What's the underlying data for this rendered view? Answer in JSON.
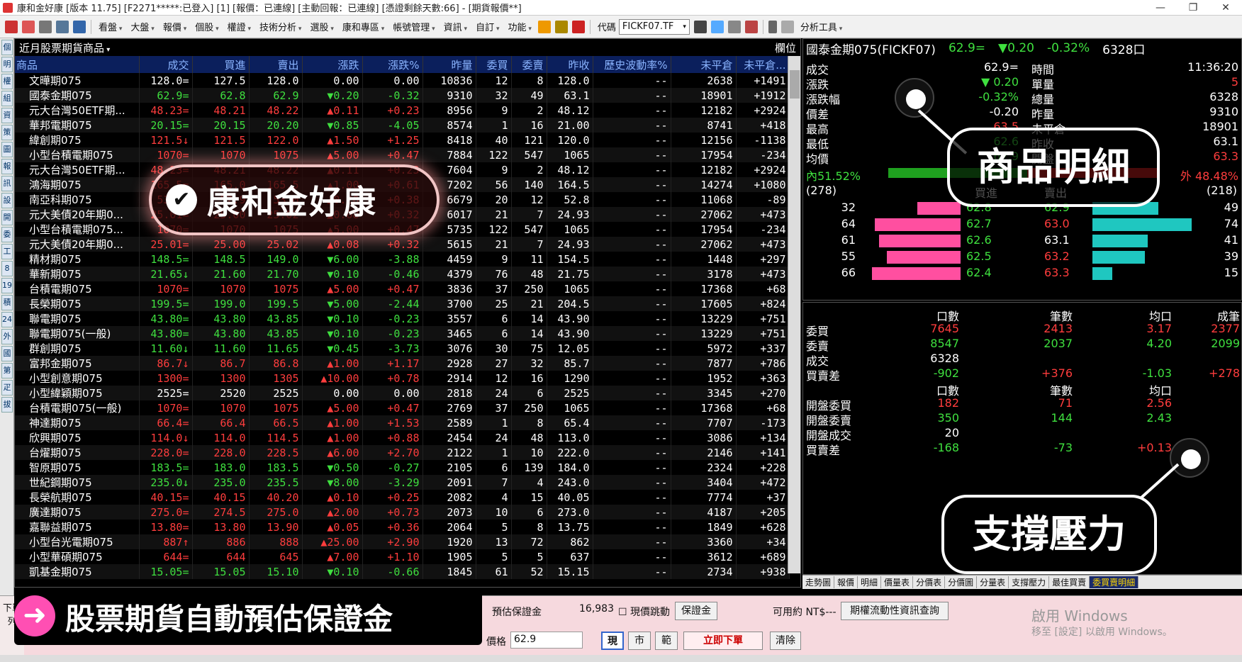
{
  "window": {
    "title": "康和金好康 [版本 11.75] [F2271*****:已登入] [1] [報價：已連線] [主動回報：已連線] [憑證剩餘天數:66] - [期貨報價**]"
  },
  "toolbar": {
    "menus": [
      "看盤",
      "大盤",
      "報價",
      "個股",
      "權證",
      "技術分析",
      "選股",
      "康和專區",
      "帳號管理",
      "資訊",
      "自訂",
      "功能"
    ],
    "code_label": "代碼",
    "code_value": "FICKF07.TF",
    "analysis_tools": "分析工具"
  },
  "left_tabs": [
    "個",
    "明",
    "權",
    "組",
    "資",
    "策",
    "圖",
    "報",
    "訊",
    "設",
    "開",
    "委",
    "工",
    "8",
    "19",
    "積",
    "24",
    "外",
    "國",
    "第",
    "疋",
    "拔"
  ],
  "quote_panel": {
    "selector": "近月股票期貨商品",
    "right_label": "欄位",
    "columns": [
      "商品",
      "成交",
      "買進",
      "賣出",
      "漲跌",
      "漲跌%",
      "昨量",
      "委買",
      "委賣",
      "昨收",
      "歷史波動率%",
      "未平倉",
      "未平倉..."
    ],
    "rows": [
      {
        "name": "文曄期075",
        "last": "128.0=",
        "bid": "127.5",
        "ask": "128.0",
        "chg": "0.00",
        "pct": "0.00",
        "vol": "10836",
        "bq": "12",
        "aq": "8",
        "prev": "128.0",
        "hv": "--",
        "oi": "2638",
        "oic": "+1491",
        "c": "w"
      },
      {
        "name": "國泰金期075",
        "last": "62.9=",
        "bid": "62.8",
        "ask": "62.9",
        "chg": "▼0.20",
        "pct": "-0.32",
        "vol": "9310",
        "bq": "32",
        "aq": "49",
        "prev": "63.1",
        "hv": "--",
        "oi": "18901",
        "oic": "+1912",
        "c": "g"
      },
      {
        "name": "元大台灣50ETF期...",
        "last": "48.23=",
        "bid": "48.21",
        "ask": "48.22",
        "chg": "▲0.11",
        "pct": "+0.23",
        "vol": "8956",
        "bq": "9",
        "aq": "2",
        "prev": "48.12",
        "hv": "--",
        "oi": "12182",
        "oic": "+2924",
        "c": "r"
      },
      {
        "name": "華邦電期075",
        "last": "20.15=",
        "bid": "20.15",
        "ask": "20.20",
        "chg": "▼0.85",
        "pct": "-4.05",
        "vol": "8574",
        "bq": "1",
        "aq": "16",
        "prev": "21.00",
        "hv": "--",
        "oi": "8741",
        "oic": "+418",
        "c": "g"
      },
      {
        "name": "緯創期075",
        "last": "121.5↓",
        "bid": "121.5",
        "ask": "122.0",
        "chg": "▲1.50",
        "pct": "+1.25",
        "vol": "8418",
        "bq": "40",
        "aq": "121",
        "prev": "120.0",
        "hv": "--",
        "oi": "12156",
        "oic": "-1138",
        "c": "r"
      },
      {
        "name": "小型台積電期075",
        "last": "1070=",
        "bid": "1070",
        "ask": "1075",
        "chg": "▲5.00",
        "pct": "+0.47",
        "vol": "7884",
        "bq": "122",
        "aq": "547",
        "prev": "1065",
        "hv": "--",
        "oi": "17954",
        "oic": "-234",
        "c": "r"
      },
      {
        "name": "元大台灣50ETF期...",
        "last": "48.23=",
        "bid": "48.21",
        "ask": "48.22",
        "chg": "▲0.11",
        "pct": "+0.23",
        "vol": "7604",
        "bq": "9",
        "aq": "2",
        "prev": "48.12",
        "hv": "--",
        "oi": "12182",
        "oic": "+2924",
        "c": "r"
      },
      {
        "name": "鴻海期075",
        "last": "165.5=",
        "bid": "165.0",
        "ask": "165.5",
        "chg": "▲1.00",
        "pct": "+0.61",
        "vol": "7202",
        "bq": "56",
        "aq": "140",
        "prev": "164.5",
        "hv": "--",
        "oi": "14274",
        "oic": "+1080",
        "c": "r"
      },
      {
        "name": "南亞科期075",
        "last": "53.0=",
        "bid": "52.9",
        "ask": "53.0",
        "chg": "▲0.20",
        "pct": "+0.38",
        "vol": "6679",
        "bq": "20",
        "aq": "12",
        "prev": "52.8",
        "hv": "--",
        "oi": "11068",
        "oic": "-89",
        "c": "r"
      },
      {
        "name": "元大美債20年期0...",
        "last": "25.01=",
        "bid": "25.00",
        "ask": "25.02",
        "chg": "▲0.08",
        "pct": "+0.32",
        "vol": "6017",
        "bq": "21",
        "aq": "7",
        "prev": "24.93",
        "hv": "--",
        "oi": "27062",
        "oic": "+473",
        "c": "r"
      },
      {
        "name": "小型台積電期075...",
        "last": "1070=",
        "bid": "1070",
        "ask": "1075",
        "chg": "▲5.00",
        "pct": "+0.47",
        "vol": "5735",
        "bq": "122",
        "aq": "547",
        "prev": "1065",
        "hv": "--",
        "oi": "17954",
        "oic": "-234",
        "c": "r"
      },
      {
        "name": "元大美債20年期0...",
        "last": "25.01=",
        "bid": "25.00",
        "ask": "25.02",
        "chg": "▲0.08",
        "pct": "+0.32",
        "vol": "5615",
        "bq": "21",
        "aq": "7",
        "prev": "24.93",
        "hv": "--",
        "oi": "27062",
        "oic": "+473",
        "c": "r"
      },
      {
        "name": "精材期075",
        "last": "148.5=",
        "bid": "148.5",
        "ask": "149.0",
        "chg": "▼6.00",
        "pct": "-3.88",
        "vol": "4459",
        "bq": "9",
        "aq": "11",
        "prev": "154.5",
        "hv": "--",
        "oi": "1448",
        "oic": "+297",
        "c": "g"
      },
      {
        "name": "華新期075",
        "last": "21.65↓",
        "bid": "21.60",
        "ask": "21.70",
        "chg": "▼0.10",
        "pct": "-0.46",
        "vol": "4379",
        "bq": "76",
        "aq": "48",
        "prev": "21.75",
        "hv": "--",
        "oi": "3178",
        "oic": "+473",
        "c": "g"
      },
      {
        "name": "台積電期075",
        "last": "1070=",
        "bid": "1070",
        "ask": "1075",
        "chg": "▲5.00",
        "pct": "+0.47",
        "vol": "3836",
        "bq": "37",
        "aq": "250",
        "prev": "1065",
        "hv": "--",
        "oi": "17368",
        "oic": "+68",
        "c": "r"
      },
      {
        "name": "長榮期075",
        "last": "199.5=",
        "bid": "199.0",
        "ask": "199.5",
        "chg": "▼5.00",
        "pct": "-2.44",
        "vol": "3700",
        "bq": "25",
        "aq": "21",
        "prev": "204.5",
        "hv": "--",
        "oi": "17605",
        "oic": "+824",
        "c": "g"
      },
      {
        "name": "聯電期075",
        "last": "43.80=",
        "bid": "43.80",
        "ask": "43.85",
        "chg": "▼0.10",
        "pct": "-0.23",
        "vol": "3557",
        "bq": "6",
        "aq": "14",
        "prev": "43.90",
        "hv": "--",
        "oi": "13229",
        "oic": "+751",
        "c": "g"
      },
      {
        "name": "聯電期075(一般)",
        "last": "43.80=",
        "bid": "43.80",
        "ask": "43.85",
        "chg": "▼0.10",
        "pct": "-0.23",
        "vol": "3465",
        "bq": "6",
        "aq": "14",
        "prev": "43.90",
        "hv": "--",
        "oi": "13229",
        "oic": "+751",
        "c": "g"
      },
      {
        "name": "群創期075",
        "last": "11.60↓",
        "bid": "11.60",
        "ask": "11.65",
        "chg": "▼0.45",
        "pct": "-3.73",
        "vol": "3076",
        "bq": "30",
        "aq": "75",
        "prev": "12.05",
        "hv": "--",
        "oi": "5972",
        "oic": "+337",
        "c": "g"
      },
      {
        "name": "富邦金期075",
        "last": "86.7↓",
        "bid": "86.7",
        "ask": "86.8",
        "chg": "▲1.00",
        "pct": "+1.17",
        "vol": "2928",
        "bq": "27",
        "aq": "32",
        "prev": "85.7",
        "hv": "--",
        "oi": "7877",
        "oic": "+786",
        "c": "r"
      },
      {
        "name": "小型創意期075",
        "last": "1300=",
        "bid": "1300",
        "ask": "1305",
        "chg": "▲10.00",
        "pct": "+0.78",
        "vol": "2914",
        "bq": "12",
        "aq": "16",
        "prev": "1290",
        "hv": "--",
        "oi": "1952",
        "oic": "+363",
        "c": "r"
      },
      {
        "name": "小型緯穎期075",
        "last": "2525=",
        "bid": "2520",
        "ask": "2525",
        "chg": "0.00",
        "pct": "0.00",
        "vol": "2818",
        "bq": "24",
        "aq": "6",
        "prev": "2525",
        "hv": "--",
        "oi": "3345",
        "oic": "+270",
        "c": "w"
      },
      {
        "name": "台積電期075(一般)",
        "last": "1070=",
        "bid": "1070",
        "ask": "1075",
        "chg": "▲5.00",
        "pct": "+0.47",
        "vol": "2769",
        "bq": "37",
        "aq": "250",
        "prev": "1065",
        "hv": "--",
        "oi": "17368",
        "oic": "+68",
        "c": "r"
      },
      {
        "name": "神達期075",
        "last": "66.4=",
        "bid": "66.4",
        "ask": "66.5",
        "chg": "▲1.00",
        "pct": "+1.53",
        "vol": "2589",
        "bq": "1",
        "aq": "8",
        "prev": "65.4",
        "hv": "--",
        "oi": "7707",
        "oic": "-173",
        "c": "r"
      },
      {
        "name": "欣興期075",
        "last": "114.0↓",
        "bid": "114.0",
        "ask": "114.5",
        "chg": "▲1.00",
        "pct": "+0.88",
        "vol": "2454",
        "bq": "24",
        "aq": "48",
        "prev": "113.0",
        "hv": "--",
        "oi": "3086",
        "oic": "+134",
        "c": "r"
      },
      {
        "name": "台燿期075",
        "last": "228.0=",
        "bid": "228.0",
        "ask": "228.5",
        "chg": "▲6.00",
        "pct": "+2.70",
        "vol": "2122",
        "bq": "1",
        "aq": "10",
        "prev": "222.0",
        "hv": "--",
        "oi": "2146",
        "oic": "+141",
        "c": "r"
      },
      {
        "name": "智原期075",
        "last": "183.5=",
        "bid": "183.0",
        "ask": "183.5",
        "chg": "▼0.50",
        "pct": "-0.27",
        "vol": "2105",
        "bq": "6",
        "aq": "139",
        "prev": "184.0",
        "hv": "--",
        "oi": "2324",
        "oic": "+228",
        "c": "g"
      },
      {
        "name": "世紀鋼期075",
        "last": "235.0↓",
        "bid": "235.0",
        "ask": "235.5",
        "chg": "▼8.00",
        "pct": "-3.29",
        "vol": "2091",
        "bq": "7",
        "aq": "4",
        "prev": "243.0",
        "hv": "--",
        "oi": "3404",
        "oic": "+472",
        "c": "g"
      },
      {
        "name": "長榮航期075",
        "last": "40.15=",
        "bid": "40.15",
        "ask": "40.20",
        "chg": "▲0.10",
        "pct": "+0.25",
        "vol": "2082",
        "bq": "4",
        "aq": "15",
        "prev": "40.05",
        "hv": "--",
        "oi": "7774",
        "oic": "+37",
        "c": "r"
      },
      {
        "name": "廣達期075",
        "last": "275.0=",
        "bid": "274.5",
        "ask": "275.0",
        "chg": "▲2.00",
        "pct": "+0.73",
        "vol": "2073",
        "bq": "10",
        "aq": "6",
        "prev": "273.0",
        "hv": "--",
        "oi": "4187",
        "oic": "+205",
        "c": "r"
      },
      {
        "name": "嘉聯益期075",
        "last": "13.80=",
        "bid": "13.80",
        "ask": "13.90",
        "chg": "▲0.05",
        "pct": "+0.36",
        "vol": "2064",
        "bq": "5",
        "aq": "8",
        "prev": "13.75",
        "hv": "--",
        "oi": "1849",
        "oic": "+628",
        "c": "r"
      },
      {
        "name": "小型台光電期075",
        "last": "887↑",
        "bid": "886",
        "ask": "888",
        "chg": "▲25.00",
        "pct": "+2.90",
        "vol": "1920",
        "bq": "13",
        "aq": "72",
        "prev": "862",
        "hv": "--",
        "oi": "3360",
        "oic": "+34",
        "c": "r"
      },
      {
        "name": "小型華碩期075",
        "last": "644=",
        "bid": "644",
        "ask": "645",
        "chg": "▲7.00",
        "pct": "+1.10",
        "vol": "1905",
        "bq": "5",
        "aq": "5",
        "prev": "637",
        "hv": "--",
        "oi": "3612",
        "oic": "+689",
        "c": "r"
      },
      {
        "name": "凱基金期075",
        "last": "15.05=",
        "bid": "15.05",
        "ask": "15.10",
        "chg": "▼0.10",
        "pct": "-0.66",
        "vol": "1845",
        "bq": "61",
        "aq": "52",
        "prev": "15.15",
        "hv": "--",
        "oi": "2734",
        "oic": "+938",
        "c": "g"
      }
    ]
  },
  "detail": {
    "name": "國泰金期075(FICKF07)",
    "price": "62.9=",
    "change": "▼0.20",
    "pct": "-0.32%",
    "vol": "6328口",
    "rows": [
      {
        "l1": "成交",
        "v1": "62.9=",
        "l2": "時間",
        "v2": "11:36:20",
        "c1": "w",
        "c2": "w"
      },
      {
        "l1": "漲跌",
        "v1": "▼ 0.20",
        "l2": "單量",
        "v2": "5",
        "c1": "g",
        "c2": "r"
      },
      {
        "l1": "漲跌幅",
        "v1": "-0.32%",
        "l2": "總量",
        "v2": "6328",
        "c1": "g",
        "c2": "w"
      },
      {
        "l1": "價差",
        "v1": "-0.20",
        "l2": "昨量",
        "v2": "9310",
        "c1": "w",
        "c2": "w"
      },
      {
        "l1": "最高",
        "v1": "63.5",
        "l2": "未平倉",
        "v2": "18901",
        "c1": "r",
        "c2": "w"
      },
      {
        "l1": "最低",
        "v1": "62.6",
        "l2": "昨收",
        "v2": "63.1",
        "c1": "g",
        "c2": "w"
      },
      {
        "l1": "均價",
        "v1": "62.9",
        "l2": "開盤",
        "v2": "63.3",
        "c1": "g",
        "c2": "r"
      }
    ],
    "inner_label": "內51.52%",
    "outer_label": "外 48.48%",
    "inner_pct": 51.52,
    "bid_total": "(278)",
    "ask_total": "(218)",
    "bid_label": "買進",
    "ask_label": "賣出",
    "depth": [
      {
        "bq": "32",
        "bp": "62.8",
        "ap": "62.9",
        "aq": "49"
      },
      {
        "bq": "64",
        "bp": "62.7",
        "ap": "63.0",
        "aq": "74"
      },
      {
        "bq": "61",
        "bp": "62.6",
        "ap": "63.1",
        "aq": "41"
      },
      {
        "bq": "55",
        "bp": "62.5",
        "ap": "63.2",
        "aq": "39"
      },
      {
        "bq": "66",
        "bp": "62.4",
        "ap": "63.3",
        "aq": "15"
      }
    ]
  },
  "stats": {
    "head1": [
      "口數",
      "筆數",
      "均口",
      "成筆"
    ],
    "rows1": [
      {
        "l": "委買",
        "a": "7645",
        "b": "2413",
        "c": "3.17",
        "d": "2377",
        "col": "r"
      },
      {
        "l": "委賣",
        "a": "8547",
        "b": "2037",
        "c": "4.20",
        "d": "2099",
        "col": "g"
      },
      {
        "l": "成交",
        "a": "6328",
        "b": "",
        "c": "",
        "d": "",
        "col": "w"
      },
      {
        "l": "買賣差",
        "a": "-902",
        "b": "+376",
        "c": "-1.03",
        "d": "+278",
        "col": "mix"
      }
    ],
    "head2": [
      "口數",
      "筆數",
      "均口"
    ],
    "rows2": [
      {
        "l": "開盤委買",
        "a": "182",
        "b": "71",
        "c": "2.56",
        "col": "r"
      },
      {
        "l": "開盤委賣",
        "a": "350",
        "b": "144",
        "c": "2.43",
        "col": "g"
      },
      {
        "l": "開盤成交",
        "a": "20",
        "b": "",
        "c": "",
        "col": "w"
      },
      {
        "l": "買賣差",
        "a": "-168",
        "b": "-73",
        "c": "+0.13",
        "col": "mix"
      }
    ]
  },
  "right_tabs": [
    "走勢圖",
    "報價",
    "明細",
    "價量表",
    "分價表",
    "分價圖",
    "分量表",
    "支撐壓力",
    "最佳買賣",
    "委買賣明細"
  ],
  "order": {
    "side_label": "下單列",
    "margin_label": "預估保證金",
    "margin_value": "16,983",
    "jump_label": "現價跳動",
    "margin_btn": "保證金",
    "available_label": "可用約 NT$---",
    "option_btn": "期權流動性資訊查詢",
    "price_label": "價格",
    "price_value": "62.9",
    "btn_now": "現",
    "btn_market": "市",
    "btn_range": "範",
    "submit": "立即下單",
    "clear": "清除",
    "watermark1": "啟用 Windows",
    "watermark2": "移至 [設定] 以啟用 Windows。"
  },
  "overlays": {
    "brand": "康和金好康",
    "detail": "商品明細",
    "support": "支撐壓力",
    "banner": "股票期貨自動預估保證金"
  }
}
